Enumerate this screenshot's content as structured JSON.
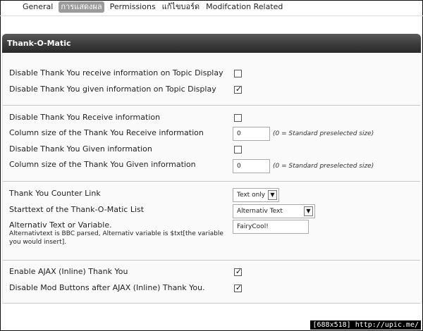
{
  "tabs": [
    {
      "label": "General",
      "active": false
    },
    {
      "label": "การแสดงผล",
      "active": true
    },
    {
      "label": "Permissions",
      "active": false
    },
    {
      "label": "แก้ไขบอร์ด",
      "active": false
    },
    {
      "label": "Modifcation Related",
      "active": false
    }
  ],
  "panel": {
    "title": "Thank-O-Matic"
  },
  "group1": {
    "receive_topic_label": "Disable Thank You receive information on Topic Display",
    "receive_topic_checked": false,
    "given_topic_label": "Disable Thank You given information on Topic Display",
    "given_topic_checked": true
  },
  "group2": {
    "receive_info_label": "Disable Thank You Receive information",
    "receive_info_checked": false,
    "receive_col_label": "Column size of the Thank You Receive information",
    "receive_col_value": "0",
    "receive_col_hint": "(0 = Standard preselected size)",
    "given_info_label": "Disable Thank You Given information",
    "given_info_checked": false,
    "given_col_label": "Column size of the Thank You Given information",
    "given_col_value": "0",
    "given_col_hint": "(0 = Standard preselected size)"
  },
  "group3": {
    "counter_link_label": "Thank You Counter Link",
    "counter_link_value": "Text only",
    "starttext_label": "Starttext of the Thank-O-Matic List",
    "starttext_value": "Alternativ Text",
    "alt_text_label": "Alternativ Text or Variable.",
    "alt_text_sublabel": "Alternativtext is BBC parsed, Alternativ variable is $txt[the variable you would insert].",
    "alt_text_value": "FairyCool!"
  },
  "group4": {
    "ajax_label": "Enable AJAX (Inline) Thank You",
    "ajax_checked": true,
    "disable_buttons_label": "Disable Mod Buttons after AJAX (Inline) Thank You.",
    "disable_buttons_checked": true
  },
  "watermark": "[688x518] http://upic.me/",
  "icons": {
    "check": "checkmark-icon",
    "dropdown": "chevron-down-icon"
  }
}
